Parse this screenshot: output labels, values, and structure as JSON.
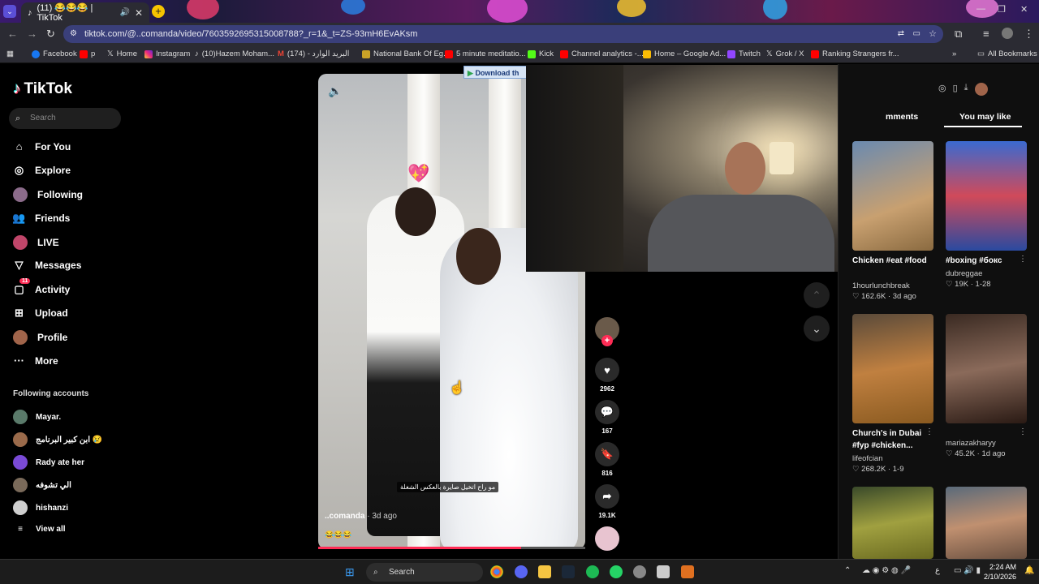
{
  "browser": {
    "tab_title": "(11) 😂😂😂 | TikTok",
    "url": "tiktok.com/@..comanda/video/7603592695315008788?_r=1&_t=ZS-93mH6EvAKsm",
    "bookmarks": [
      "Facebook",
      "p",
      "Home",
      "Instagram",
      "(10)Hazem Moham...",
      "(174) - البريد الوارد",
      "National Bank Of Eg...",
      "5 minute meditatio...",
      "Kick",
      "Channel analytics -...",
      "Home – Google Ad...",
      "Twitch",
      "Grok / X",
      "Ranking Strangers fr..."
    ],
    "all_bookmarks": "All Bookmarks"
  },
  "sidebar": {
    "logo": "TikTok",
    "search_placeholder": "Search",
    "nav": [
      "For You",
      "Explore",
      "Following",
      "Friends",
      "LIVE",
      "Messages",
      "Activity",
      "Upload",
      "Profile",
      "More"
    ],
    "activity_badge": "11",
    "following_header": "Following accounts",
    "following": [
      "Mayar.",
      "ابن كبير البرنامج 😢",
      "Rady ate her",
      "الي تشوفه",
      "hishanzi"
    ],
    "view_all": "View all"
  },
  "video": {
    "author": "..comanda",
    "ago": " · 3d ago",
    "emoji": "😂😂😂",
    "caption_overlay": "مو راح اتخيل صايرة بالعكس الشغلة",
    "progress": 0.76,
    "download_label": "Download th"
  },
  "actions": {
    "likes": "2962",
    "comments": "167",
    "saves": "816",
    "shares": "19.1K"
  },
  "rightpanel": {
    "tab_comments": "mments",
    "tab_you_may_like": "You may like",
    "cards": [
      {
        "title": "Chicken #eat #food",
        "user": "1hourlunchbreak",
        "likes": "162.6K",
        "date": "3d ago"
      },
      {
        "title": "#boxing #бокс",
        "user": "dubreggae",
        "likes": "19K",
        "date": "1-28"
      },
      {
        "title": "Church's in Dubai #fyp #chicken...",
        "user": "lifeofcian",
        "likes": "268.2K",
        "date": "1-9"
      },
      {
        "title": "",
        "user": "mariazakharyy",
        "likes": "45.2K",
        "date": "1d ago"
      }
    ]
  },
  "taskbar": {
    "search": "Search",
    "time": "2:24 AM",
    "date": "2/10/2026"
  }
}
